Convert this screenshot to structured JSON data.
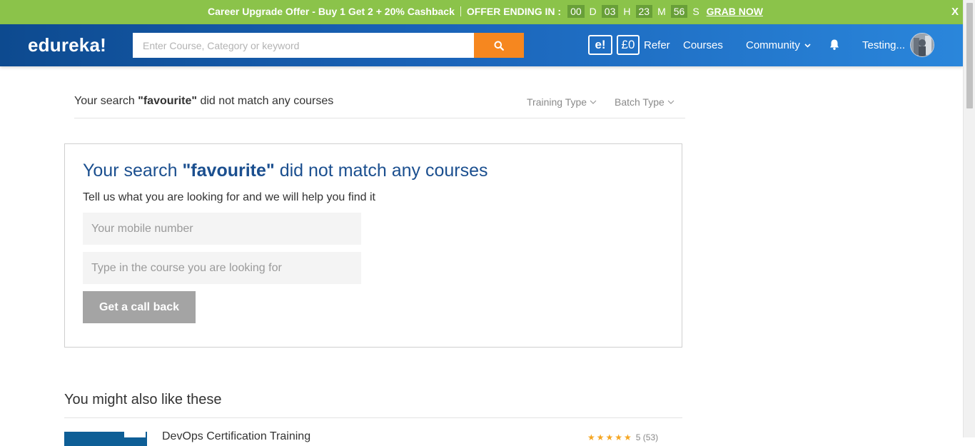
{
  "promo": {
    "text": "Career Upgrade Offer - Buy 1 Get 2 + 20% Cashback",
    "ending_label": "OFFER ENDING IN :",
    "countdown": [
      {
        "value": "00",
        "unit": "D"
      },
      {
        "value": "03",
        "unit": "H"
      },
      {
        "value": "23",
        "unit": "M"
      },
      {
        "value": "56",
        "unit": "S"
      }
    ],
    "cta": "GRAB NOW",
    "close": "X"
  },
  "header": {
    "logo": "edureka!",
    "search_placeholder": "Enter Course, Category or keyword",
    "ecoin_label": "e!",
    "balance": "£0",
    "refer": "Refer",
    "courses": "Courses",
    "community": "Community",
    "user": "Testing..."
  },
  "results": {
    "summary_prefix": "Your search ",
    "query": "\"favourite\"",
    "summary_suffix": " did not match any courses",
    "filters": [
      "Training Type",
      "Batch Type"
    ]
  },
  "card": {
    "title_prefix": "Your search ",
    "title_query": "\"favourite\"",
    "title_suffix": " did not match any courses",
    "subtitle": "Tell us what you are looking for and we will help you find it",
    "mobile_placeholder": "Your mobile number",
    "course_placeholder": "Type in the course you are looking for",
    "button": "Get a call back"
  },
  "recommendations": {
    "heading": "You might also like these",
    "items": [
      {
        "title": "DevOps Certification Training",
        "stars": "★★★★★",
        "rating_text": "5 (53)"
      }
    ]
  },
  "colors": {
    "promo_bg": "#8bc34a",
    "header_start": "#0d4a8f",
    "header_end": "#2a86db",
    "search_button": "#f6871f",
    "title_blue": "#1b4f8f",
    "callback_button": "#a4a4a4"
  }
}
